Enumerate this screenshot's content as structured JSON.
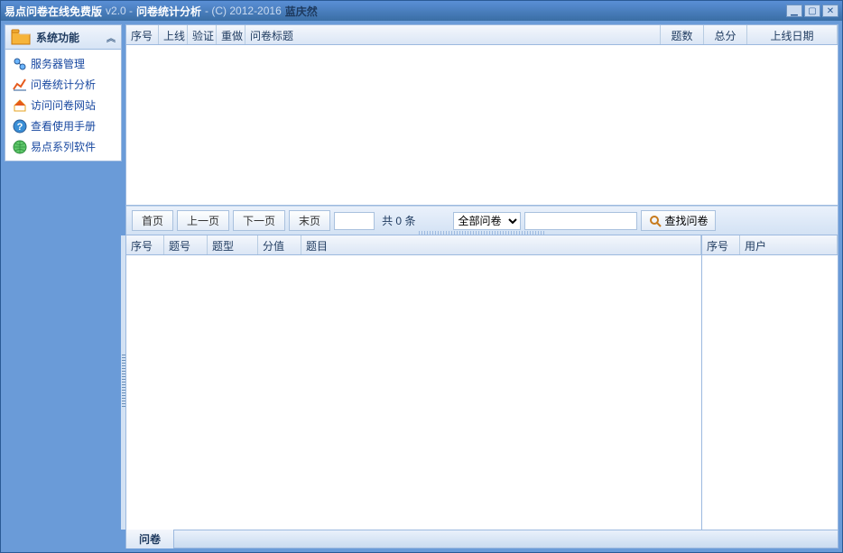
{
  "titlebar": {
    "main": "易点问卷在线免费版",
    "version": "v2.0 -",
    "section": "问卷统计分析",
    "copyright": "- (C) 2012-2016",
    "author": "蓝庆然"
  },
  "sidebar": {
    "header": "系统功能",
    "items": [
      {
        "label": "服务器管理"
      },
      {
        "label": "问卷统计分析"
      },
      {
        "label": "访问问卷网站"
      },
      {
        "label": "查看使用手册"
      },
      {
        "label": "易点系列软件"
      }
    ]
  },
  "top_grid": {
    "cols": [
      "序号",
      "上线",
      "验证",
      "重做",
      "问卷标题",
      "题数",
      "总分",
      "上线日期"
    ]
  },
  "toolbar": {
    "first": "首页",
    "prev": "上一页",
    "next": "下一页",
    "last": "末页",
    "count_prefix": "共",
    "count_value": "0",
    "count_suffix": "条",
    "filter_option": "全部问卷",
    "search": "查找问卷"
  },
  "bottom_left_grid": {
    "cols": [
      "序号",
      "题号",
      "题型",
      "分值",
      "题目"
    ]
  },
  "bottom_right_grid": {
    "cols": [
      "序号",
      "用户"
    ]
  },
  "statusbar": {
    "tab": "问卷"
  }
}
